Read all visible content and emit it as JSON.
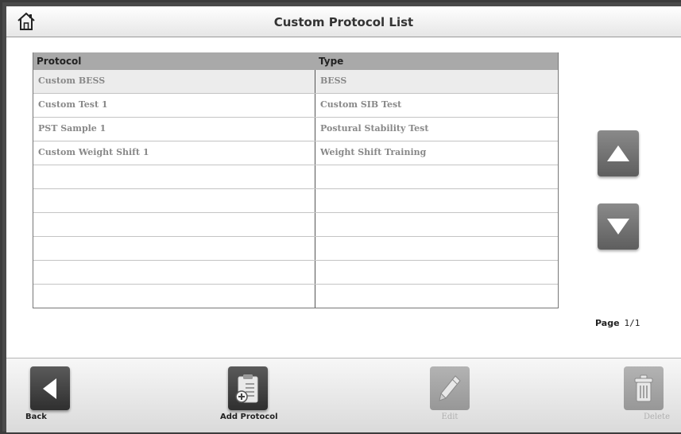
{
  "header": {
    "title": "Custom Protocol List"
  },
  "table": {
    "columns": [
      "Protocol",
      "Type"
    ],
    "rows": [
      {
        "protocol": "Custom BESS",
        "type": "BESS",
        "selected": true
      },
      {
        "protocol": "Custom Test 1",
        "type": "Custom SIB Test"
      },
      {
        "protocol": "PST Sample 1",
        "type": "Postural Stability Test"
      },
      {
        "protocol": "Custom Weight Shift 1",
        "type": "Weight Shift Training"
      },
      {
        "protocol": "",
        "type": ""
      },
      {
        "protocol": "",
        "type": ""
      },
      {
        "protocol": "",
        "type": ""
      },
      {
        "protocol": "",
        "type": ""
      },
      {
        "protocol": "",
        "type": ""
      },
      {
        "protocol": "",
        "type": ""
      }
    ]
  },
  "pagination": {
    "label": "Page",
    "value": "1/1"
  },
  "toolbar": {
    "back_label": "Back",
    "add_label": "Add Protocol",
    "edit_label": "Edit",
    "delete_label": "Delete"
  },
  "icons": {
    "home": "home-icon",
    "up": "up-arrow-icon",
    "down": "down-arrow-icon",
    "back": "back-arrow-icon",
    "add": "clipboard-add-icon",
    "edit": "pencil-icon",
    "delete": "trash-icon"
  }
}
